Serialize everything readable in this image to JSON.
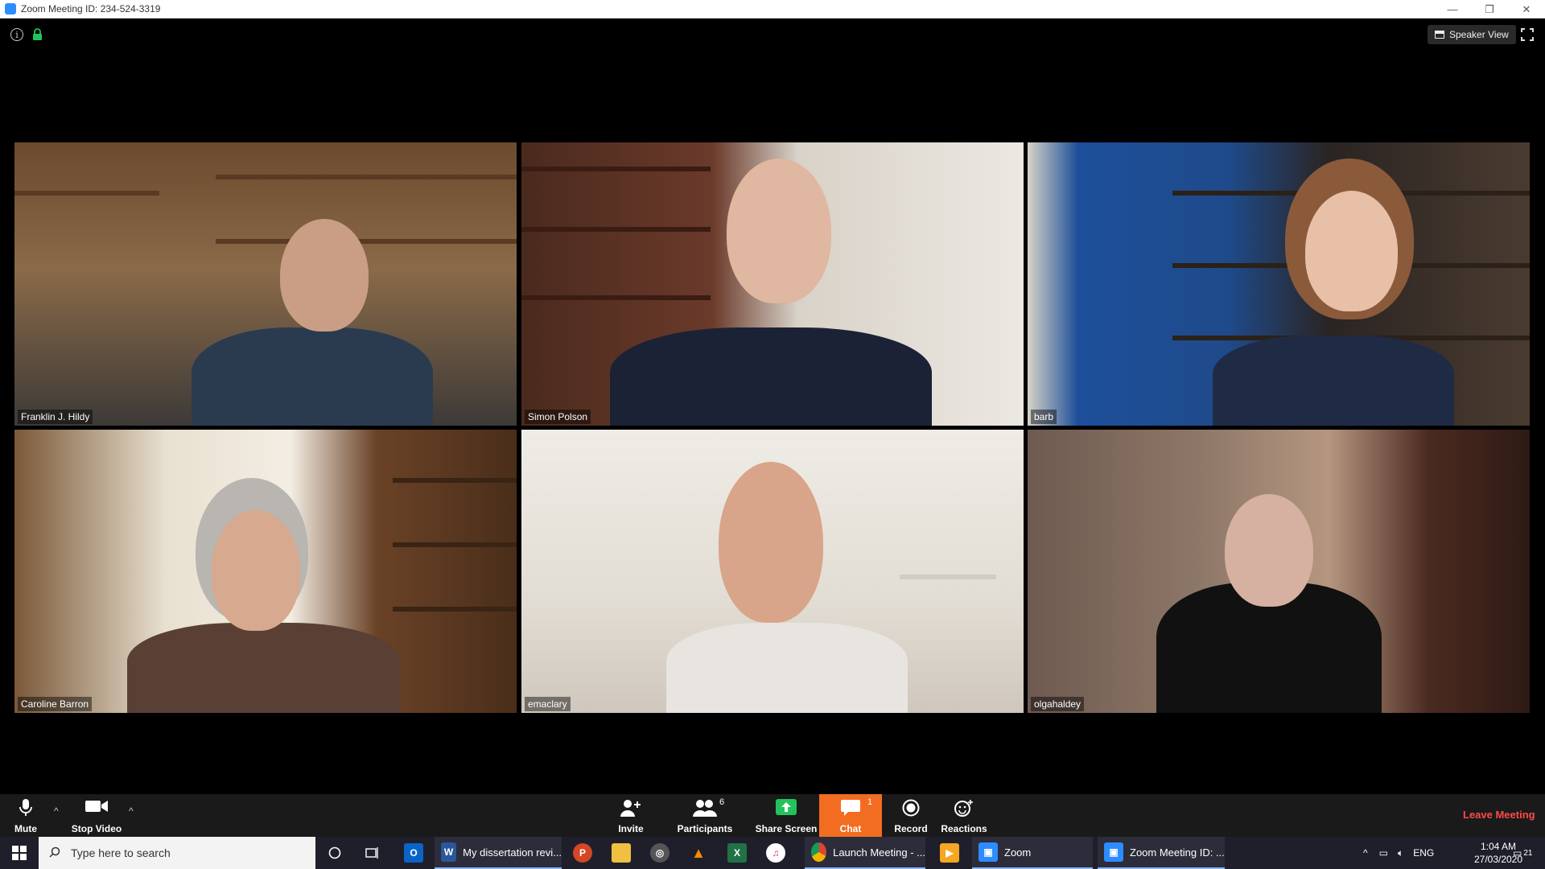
{
  "window": {
    "title": "Zoom Meeting ID: 234-524-3319",
    "controls": [
      "—",
      "❐",
      "✕"
    ]
  },
  "meeting_top": {
    "speaker_view_label": "Speaker View"
  },
  "participants": [
    {
      "name": "Franklin J. Hildy"
    },
    {
      "name": "Simon Polson"
    },
    {
      "name": "barb"
    },
    {
      "name": "Caroline Barron"
    },
    {
      "name": "emaclary"
    },
    {
      "name": "olgahaldey"
    }
  ],
  "controls": {
    "mute": "Mute",
    "stop_video": "Stop Video",
    "invite": "Invite",
    "participants": "Participants",
    "participants_count": "6",
    "share_screen": "Share Screen",
    "chat": "Chat",
    "chat_badge": "1",
    "record": "Record",
    "reactions": "Reactions",
    "leave": "Leave Meeting"
  },
  "colors": {
    "active_speaker_border": "#c9d96a",
    "chat_accent": "#f26d21",
    "leave_red": "#ff4a4a",
    "share_green": "#22c35d"
  },
  "taskbar": {
    "search_placeholder": "Type here to search",
    "word_label": "My dissertation revi...",
    "chrome_label": "Launch Meeting - ...",
    "zoom_label": "Zoom",
    "zoom_meeting_label": "Zoom Meeting ID: ...",
    "language": "ENG",
    "time": "1:04 AM",
    "date": "27/03/2020",
    "notification_count": "21"
  }
}
